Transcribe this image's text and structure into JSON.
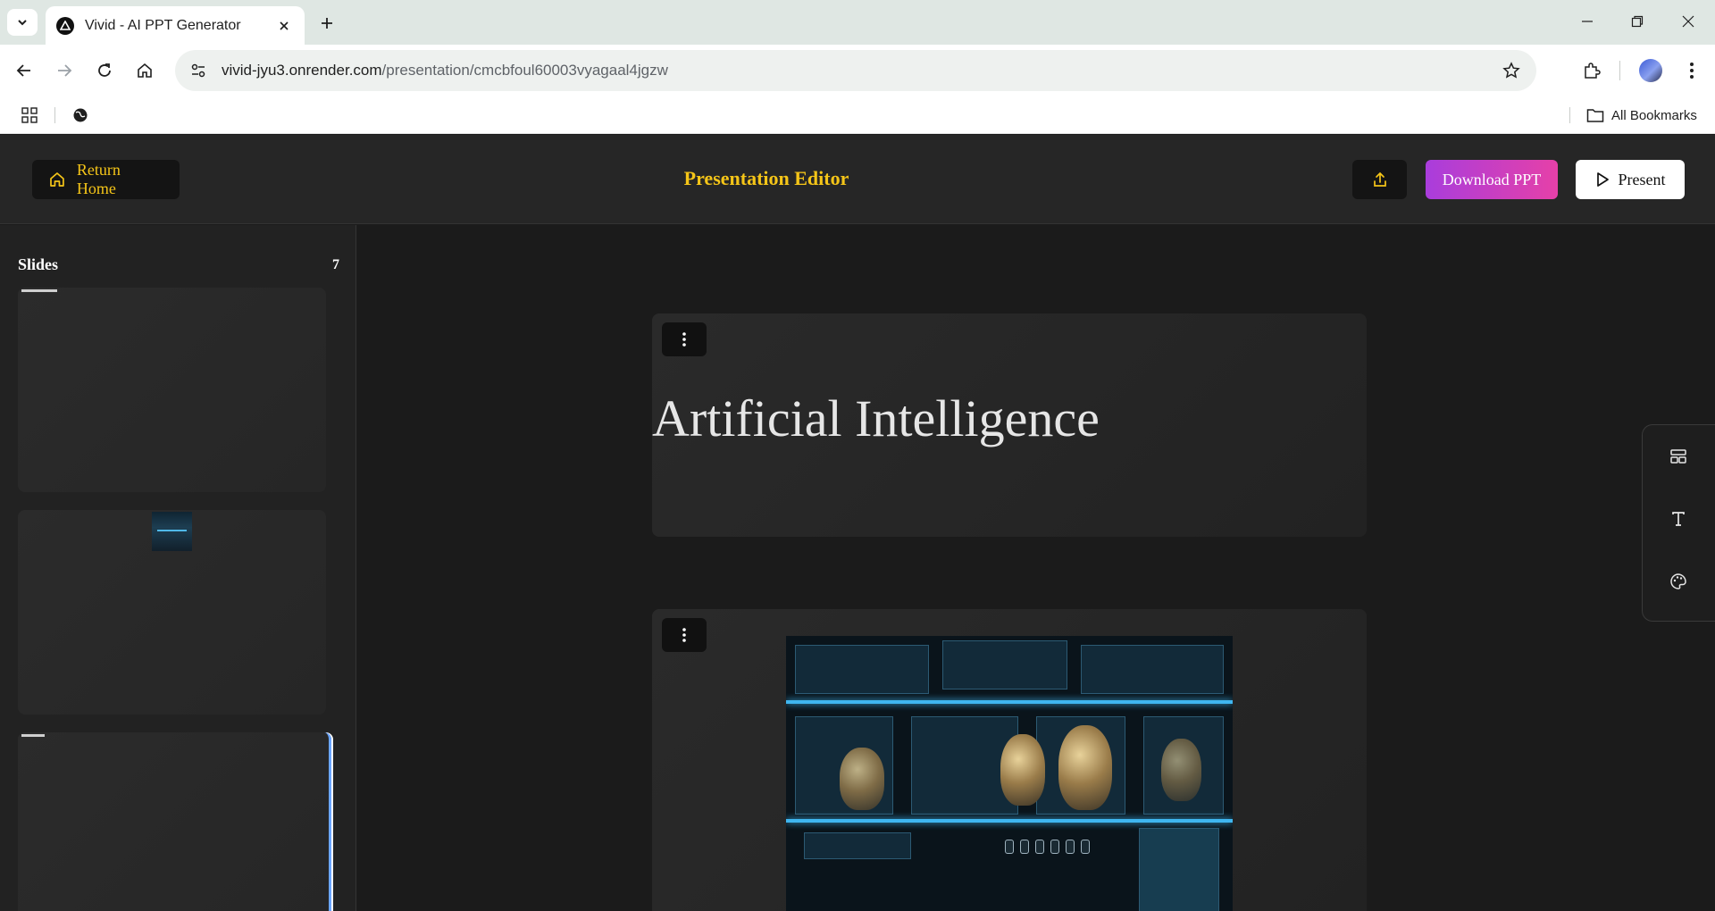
{
  "browser": {
    "tab_title": "Vivid - AI PPT Generator",
    "url_host": "vivid-jyu3.onrender.com",
    "url_path": "/presentation/cmcbfoul60003vyagaal4jgzw",
    "all_bookmarks_label": "All Bookmarks"
  },
  "header": {
    "return_home_label": "Return Home",
    "title": "Presentation Editor",
    "download_label": "Download PPT",
    "present_label": "Present"
  },
  "sidebar": {
    "title": "Slides",
    "count": "7"
  },
  "slides": [
    {
      "heading": "Artificial Intelligence"
    }
  ],
  "colors": {
    "accent": "#f5c518",
    "download_gradient_start": "#a93ddc",
    "download_gradient_end": "#e640a8",
    "selected_slide_border": "#6aa5ff"
  },
  "icons": {
    "share": "upload-share-icon",
    "home": "home-icon",
    "present": "play-icon",
    "slide_menu": "vertical-dots-icon",
    "layout": "layout-icon",
    "text": "text-icon",
    "theme": "palette-icon"
  }
}
